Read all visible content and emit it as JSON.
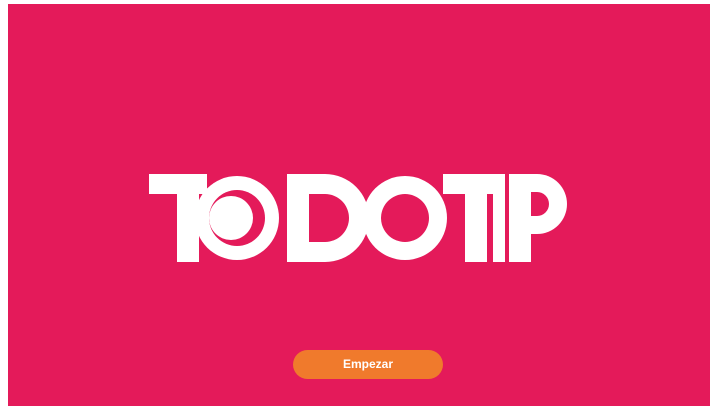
{
  "app": {
    "brand_logo_text": "TODOTIP",
    "colors": {
      "background": "#e41a5a",
      "logo": "#ffffff",
      "button": "#f07a2c",
      "button_text": "#ffffff"
    }
  },
  "actions": {
    "start_label": "Empezar"
  }
}
